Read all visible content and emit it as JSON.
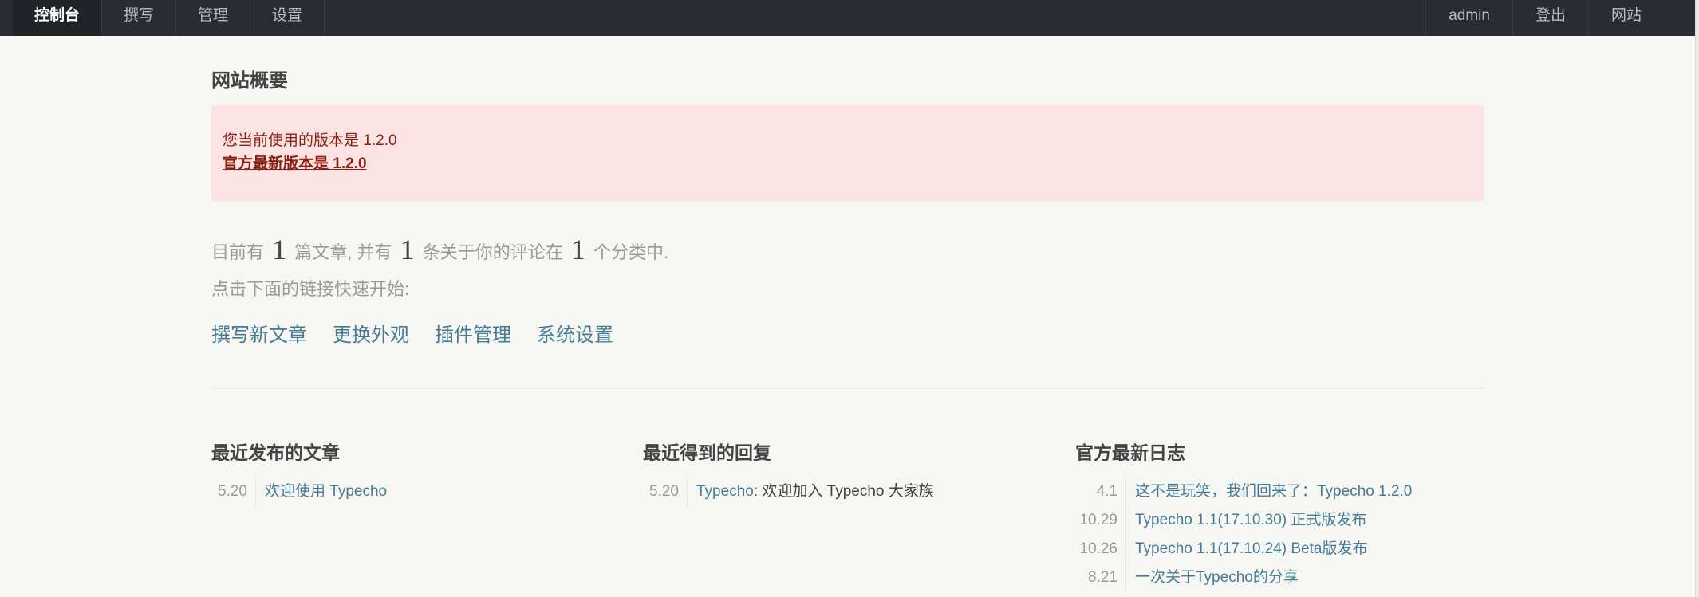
{
  "nav": {
    "left": [
      "控制台",
      "撰写",
      "管理",
      "设置"
    ],
    "right": [
      "admin",
      "登出",
      "网站"
    ]
  },
  "page": {
    "title": "网站概要",
    "alert_line1": "您当前使用的版本是 1.2.0",
    "alert_line2": "官方最新版本是 1.2.0"
  },
  "stats": {
    "prefix": "目前有",
    "posts_count": "1",
    "mid1": "篇文章, 并有",
    "comments_count": "1",
    "mid2": "条关于你的评论在",
    "categories_count": "1",
    "suffix": "个分类中.",
    "hint": "点击下面的链接快速开始:"
  },
  "quick_links": [
    "撰写新文章",
    "更换外观",
    "插件管理",
    "系统设置"
  ],
  "recent_posts": {
    "title": "最近发布的文章",
    "items": [
      {
        "date": "5.20",
        "title": "欢迎使用 Typecho"
      }
    ]
  },
  "recent_comments": {
    "title": "最近得到的回复",
    "items": [
      {
        "date": "5.20",
        "author": "Typecho",
        "text": ": 欢迎加入 Typecho 大家族"
      }
    ]
  },
  "official_news": {
    "title": "官方最新日志",
    "items": [
      {
        "date": "4.1",
        "title": "这不是玩笑，我们回来了：Typecho 1.2.0"
      },
      {
        "date": "10.29",
        "title": "Typecho 1.1(17.10.30) 正式版发布"
      },
      {
        "date": "10.26",
        "title": "Typecho 1.1(17.10.24) Beta版发布"
      },
      {
        "date": "8.21",
        "title": "一次关于Typecho的分享"
      }
    ]
  }
}
